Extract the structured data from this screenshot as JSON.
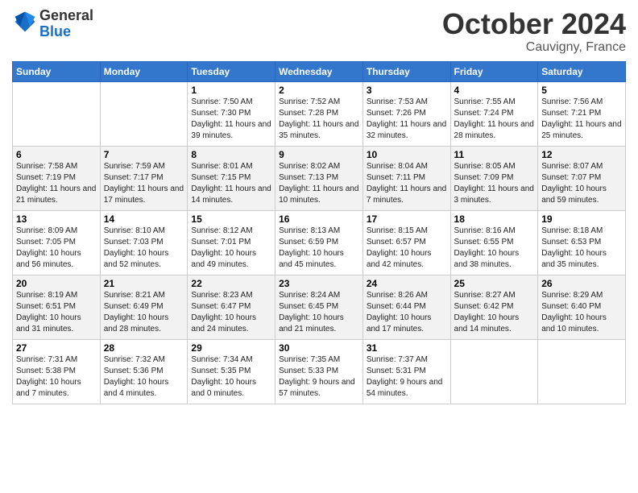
{
  "logo": {
    "general": "General",
    "blue": "Blue"
  },
  "header": {
    "month_title": "October 2024",
    "location": "Cauvigny, France"
  },
  "days_of_week": [
    "Sunday",
    "Monday",
    "Tuesday",
    "Wednesday",
    "Thursday",
    "Friday",
    "Saturday"
  ],
  "weeks": [
    [
      {
        "day": "",
        "info": ""
      },
      {
        "day": "",
        "info": ""
      },
      {
        "day": "1",
        "info": "Sunrise: 7:50 AM\nSunset: 7:30 PM\nDaylight: 11 hours and 39 minutes."
      },
      {
        "day": "2",
        "info": "Sunrise: 7:52 AM\nSunset: 7:28 PM\nDaylight: 11 hours and 35 minutes."
      },
      {
        "day": "3",
        "info": "Sunrise: 7:53 AM\nSunset: 7:26 PM\nDaylight: 11 hours and 32 minutes."
      },
      {
        "day": "4",
        "info": "Sunrise: 7:55 AM\nSunset: 7:24 PM\nDaylight: 11 hours and 28 minutes."
      },
      {
        "day": "5",
        "info": "Sunrise: 7:56 AM\nSunset: 7:21 PM\nDaylight: 11 hours and 25 minutes."
      }
    ],
    [
      {
        "day": "6",
        "info": "Sunrise: 7:58 AM\nSunset: 7:19 PM\nDaylight: 11 hours and 21 minutes."
      },
      {
        "day": "7",
        "info": "Sunrise: 7:59 AM\nSunset: 7:17 PM\nDaylight: 11 hours and 17 minutes."
      },
      {
        "day": "8",
        "info": "Sunrise: 8:01 AM\nSunset: 7:15 PM\nDaylight: 11 hours and 14 minutes."
      },
      {
        "day": "9",
        "info": "Sunrise: 8:02 AM\nSunset: 7:13 PM\nDaylight: 11 hours and 10 minutes."
      },
      {
        "day": "10",
        "info": "Sunrise: 8:04 AM\nSunset: 7:11 PM\nDaylight: 11 hours and 7 minutes."
      },
      {
        "day": "11",
        "info": "Sunrise: 8:05 AM\nSunset: 7:09 PM\nDaylight: 11 hours and 3 minutes."
      },
      {
        "day": "12",
        "info": "Sunrise: 8:07 AM\nSunset: 7:07 PM\nDaylight: 10 hours and 59 minutes."
      }
    ],
    [
      {
        "day": "13",
        "info": "Sunrise: 8:09 AM\nSunset: 7:05 PM\nDaylight: 10 hours and 56 minutes."
      },
      {
        "day": "14",
        "info": "Sunrise: 8:10 AM\nSunset: 7:03 PM\nDaylight: 10 hours and 52 minutes."
      },
      {
        "day": "15",
        "info": "Sunrise: 8:12 AM\nSunset: 7:01 PM\nDaylight: 10 hours and 49 minutes."
      },
      {
        "day": "16",
        "info": "Sunrise: 8:13 AM\nSunset: 6:59 PM\nDaylight: 10 hours and 45 minutes."
      },
      {
        "day": "17",
        "info": "Sunrise: 8:15 AM\nSunset: 6:57 PM\nDaylight: 10 hours and 42 minutes."
      },
      {
        "day": "18",
        "info": "Sunrise: 8:16 AM\nSunset: 6:55 PM\nDaylight: 10 hours and 38 minutes."
      },
      {
        "day": "19",
        "info": "Sunrise: 8:18 AM\nSunset: 6:53 PM\nDaylight: 10 hours and 35 minutes."
      }
    ],
    [
      {
        "day": "20",
        "info": "Sunrise: 8:19 AM\nSunset: 6:51 PM\nDaylight: 10 hours and 31 minutes."
      },
      {
        "day": "21",
        "info": "Sunrise: 8:21 AM\nSunset: 6:49 PM\nDaylight: 10 hours and 28 minutes."
      },
      {
        "day": "22",
        "info": "Sunrise: 8:23 AM\nSunset: 6:47 PM\nDaylight: 10 hours and 24 minutes."
      },
      {
        "day": "23",
        "info": "Sunrise: 8:24 AM\nSunset: 6:45 PM\nDaylight: 10 hours and 21 minutes."
      },
      {
        "day": "24",
        "info": "Sunrise: 8:26 AM\nSunset: 6:44 PM\nDaylight: 10 hours and 17 minutes."
      },
      {
        "day": "25",
        "info": "Sunrise: 8:27 AM\nSunset: 6:42 PM\nDaylight: 10 hours and 14 minutes."
      },
      {
        "day": "26",
        "info": "Sunrise: 8:29 AM\nSunset: 6:40 PM\nDaylight: 10 hours and 10 minutes."
      }
    ],
    [
      {
        "day": "27",
        "info": "Sunrise: 7:31 AM\nSunset: 5:38 PM\nDaylight: 10 hours and 7 minutes."
      },
      {
        "day": "28",
        "info": "Sunrise: 7:32 AM\nSunset: 5:36 PM\nDaylight: 10 hours and 4 minutes."
      },
      {
        "day": "29",
        "info": "Sunrise: 7:34 AM\nSunset: 5:35 PM\nDaylight: 10 hours and 0 minutes."
      },
      {
        "day": "30",
        "info": "Sunrise: 7:35 AM\nSunset: 5:33 PM\nDaylight: 9 hours and 57 minutes."
      },
      {
        "day": "31",
        "info": "Sunrise: 7:37 AM\nSunset: 5:31 PM\nDaylight: 9 hours and 54 minutes."
      },
      {
        "day": "",
        "info": ""
      },
      {
        "day": "",
        "info": ""
      }
    ]
  ]
}
